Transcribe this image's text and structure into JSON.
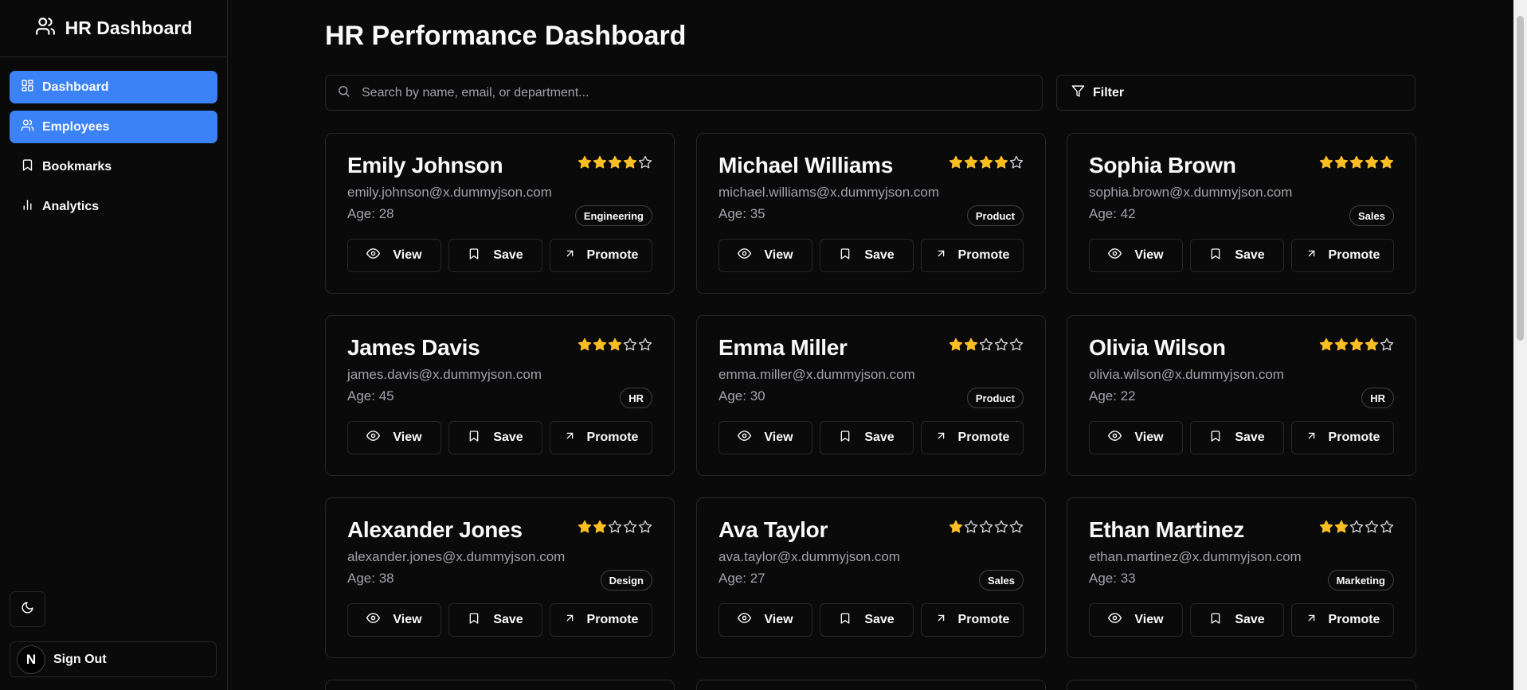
{
  "sidebar": {
    "brand": "HR Dashboard",
    "items": [
      {
        "label": "Dashboard",
        "icon": "dashboard-icon",
        "active": true
      },
      {
        "label": "Employees",
        "icon": "users-icon",
        "active": true
      },
      {
        "label": "Bookmarks",
        "icon": "bookmark-icon",
        "active": false
      },
      {
        "label": "Analytics",
        "icon": "bar-chart-icon",
        "active": false
      }
    ],
    "theme_toggle_icon": "moon-icon",
    "signout_label": "Sign Out",
    "avatar_letter": "N"
  },
  "main": {
    "title": "HR Performance Dashboard",
    "search_placeholder": "Search by name, email, or department...",
    "filter_label": "Filter"
  },
  "actions": {
    "view": "View",
    "save": "Save",
    "promote": "Promote"
  },
  "colors": {
    "accent": "#3b82f6",
    "star": "#fbbf24"
  },
  "employees": [
    {
      "name": "Emily Johnson",
      "email": "emily.johnson@x.dummyjson.com",
      "age": "Age: 28",
      "department": "Engineering",
      "rating": 4
    },
    {
      "name": "Michael Williams",
      "email": "michael.williams@x.dummyjson.com",
      "age": "Age: 35",
      "department": "Product",
      "rating": 4
    },
    {
      "name": "Sophia Brown",
      "email": "sophia.brown@x.dummyjson.com",
      "age": "Age: 42",
      "department": "Sales",
      "rating": 5
    },
    {
      "name": "James Davis",
      "email": "james.davis@x.dummyjson.com",
      "age": "Age: 45",
      "department": "HR",
      "rating": 3
    },
    {
      "name": "Emma Miller",
      "email": "emma.miller@x.dummyjson.com",
      "age": "Age: 30",
      "department": "Product",
      "rating": 2
    },
    {
      "name": "Olivia Wilson",
      "email": "olivia.wilson@x.dummyjson.com",
      "age": "Age: 22",
      "department": "HR",
      "rating": 4
    },
    {
      "name": "Alexander Jones",
      "email": "alexander.jones@x.dummyjson.com",
      "age": "Age: 38",
      "department": "Design",
      "rating": 2
    },
    {
      "name": "Ava Taylor",
      "email": "ava.taylor@x.dummyjson.com",
      "age": "Age: 27",
      "department": "Sales",
      "rating": 1
    },
    {
      "name": "Ethan Martinez",
      "email": "ethan.martinez@x.dummyjson.com",
      "age": "Age: 33",
      "department": "Marketing",
      "rating": 2
    }
  ]
}
